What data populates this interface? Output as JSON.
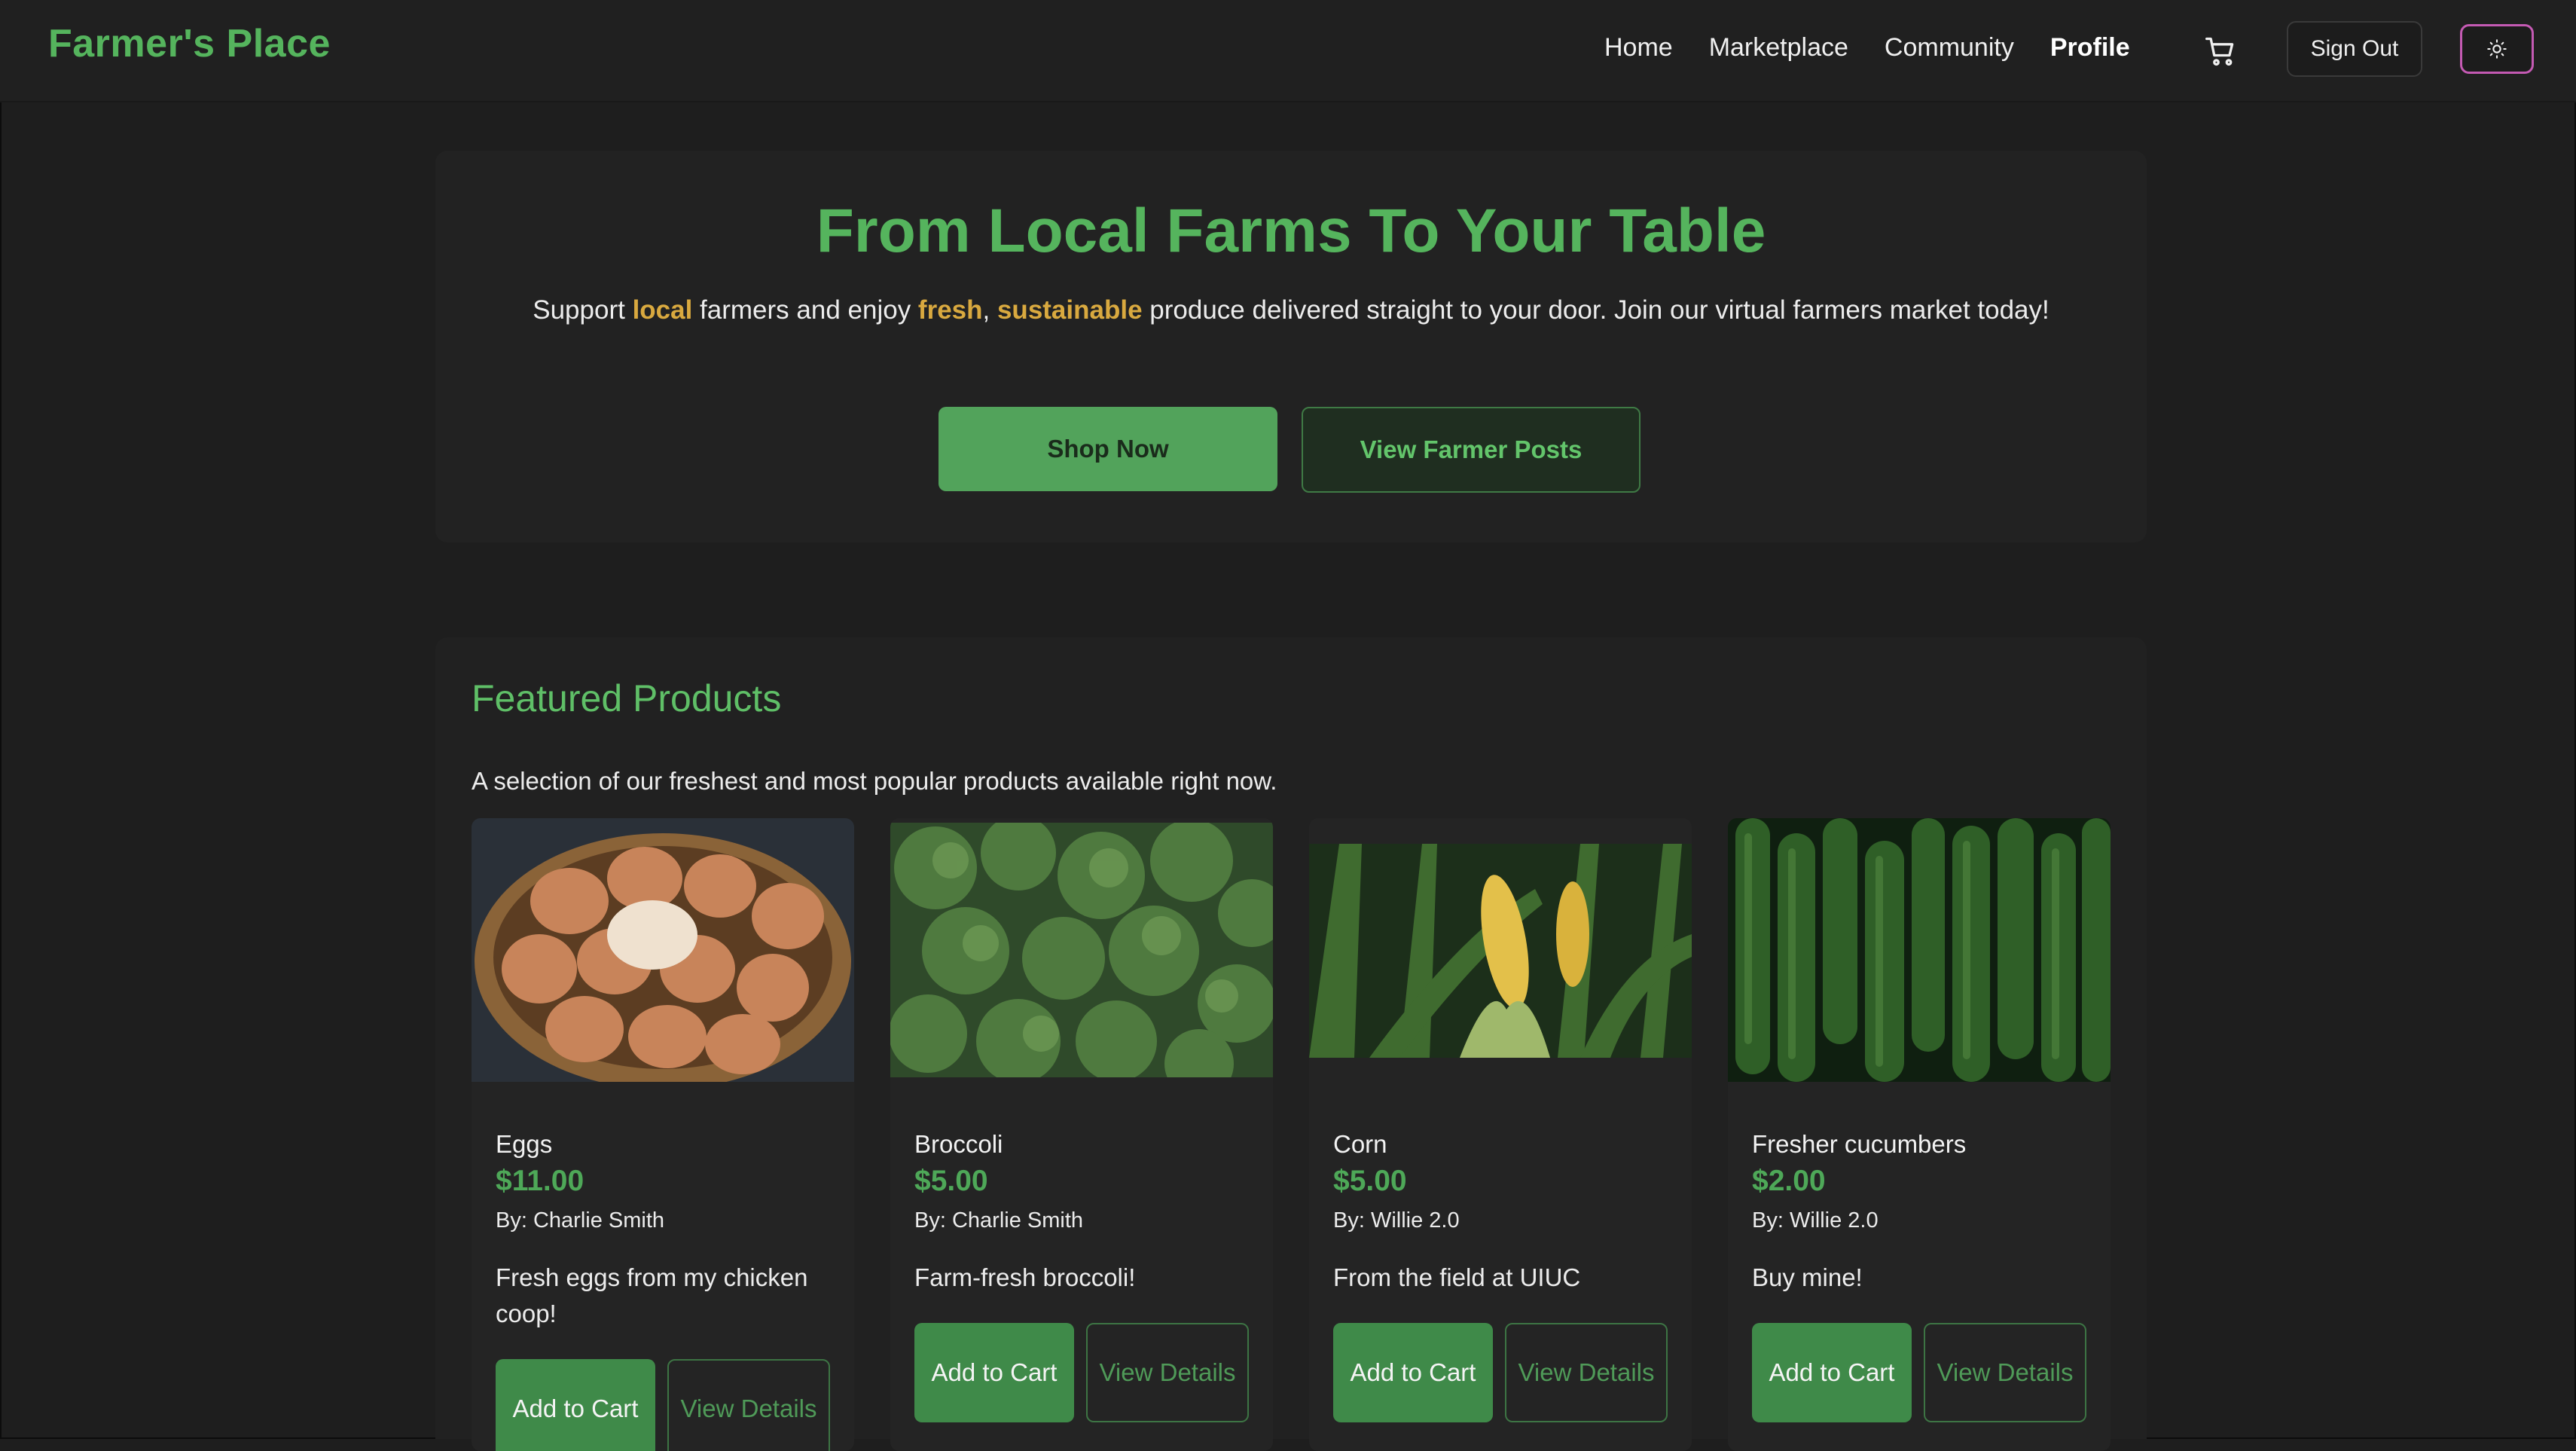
{
  "nav": {
    "brand": "Farmer's Place",
    "links": [
      "Home",
      "Marketplace",
      "Community",
      "Profile"
    ],
    "active": "Profile",
    "sign_out": "Sign Out",
    "icons": {
      "cart": "cart-icon",
      "theme": "sun-icon"
    },
    "theme_border_color": "#c45ab3"
  },
  "hero": {
    "title": "From Local Farms To Your Table",
    "sub_1": "Support ",
    "hl_1": "local",
    "sub_2": " farmers and enjoy ",
    "hl_2": "fresh",
    "sub_3": ", ",
    "hl_3": "sustainable",
    "sub_4": " produce delivered straight to your door. Join our virtual farmers market today!",
    "shop_now": "Shop Now",
    "view_posts": "View Farmer Posts"
  },
  "featured": {
    "title": "Featured Products",
    "subtitle": "A selection of our freshest and most popular products available right now.",
    "add_label": "Add to Cart",
    "view_label": "View Details",
    "products": [
      {
        "name": "Eggs",
        "price": "$11.00",
        "by": "By: Charlie Smith",
        "desc": "Fresh eggs from my chicken coop!"
      },
      {
        "name": "Broccoli",
        "price": "$5.00",
        "by": "By: Charlie Smith",
        "desc": "Farm-fresh broccoli!"
      },
      {
        "name": "Corn",
        "price": "$5.00",
        "by": "By: Willie 2.0",
        "desc": "From the field at UIUC"
      },
      {
        "name": "Fresher cucumbers",
        "price": "$2.00",
        "by": "By: Willie 2.0",
        "desc": "Buy mine!"
      }
    ]
  },
  "colors": {
    "brand_green": "#55b45d",
    "highlight": "#d9a93f",
    "button_green": "#52a35b"
  }
}
